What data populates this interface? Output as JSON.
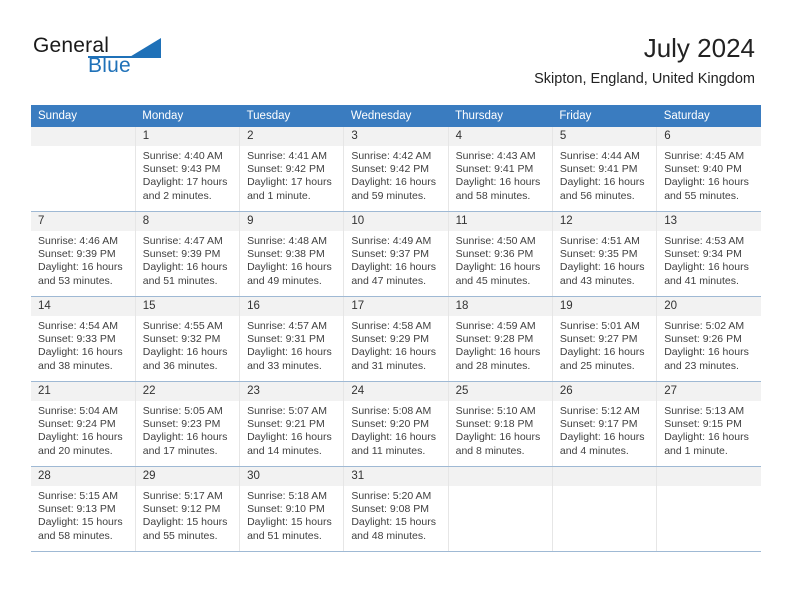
{
  "brand": {
    "line1": "General",
    "line2": "Blue",
    "accent_color": "#1f71b8",
    "triangle_icon": "triangle-logo-icon"
  },
  "header": {
    "month_title": "July 2024",
    "location": "Skipton, England, United Kingdom"
  },
  "calendar": {
    "header_bg": "#3a7cc0",
    "weekday_headers": [
      "Sunday",
      "Monday",
      "Tuesday",
      "Wednesday",
      "Thursday",
      "Friday",
      "Saturday"
    ],
    "weeks": [
      [
        {
          "day": "",
          "sunrise": "",
          "sunset": "",
          "daylight": ""
        },
        {
          "day": "1",
          "sunrise": "Sunrise: 4:40 AM",
          "sunset": "Sunset: 9:43 PM",
          "daylight": "Daylight: 17 hours and 2 minutes."
        },
        {
          "day": "2",
          "sunrise": "Sunrise: 4:41 AM",
          "sunset": "Sunset: 9:42 PM",
          "daylight": "Daylight: 17 hours and 1 minute."
        },
        {
          "day": "3",
          "sunrise": "Sunrise: 4:42 AM",
          "sunset": "Sunset: 9:42 PM",
          "daylight": "Daylight: 16 hours and 59 minutes."
        },
        {
          "day": "4",
          "sunrise": "Sunrise: 4:43 AM",
          "sunset": "Sunset: 9:41 PM",
          "daylight": "Daylight: 16 hours and 58 minutes."
        },
        {
          "day": "5",
          "sunrise": "Sunrise: 4:44 AM",
          "sunset": "Sunset: 9:41 PM",
          "daylight": "Daylight: 16 hours and 56 minutes."
        },
        {
          "day": "6",
          "sunrise": "Sunrise: 4:45 AM",
          "sunset": "Sunset: 9:40 PM",
          "daylight": "Daylight: 16 hours and 55 minutes."
        }
      ],
      [
        {
          "day": "7",
          "sunrise": "Sunrise: 4:46 AM",
          "sunset": "Sunset: 9:39 PM",
          "daylight": "Daylight: 16 hours and 53 minutes."
        },
        {
          "day": "8",
          "sunrise": "Sunrise: 4:47 AM",
          "sunset": "Sunset: 9:39 PM",
          "daylight": "Daylight: 16 hours and 51 minutes."
        },
        {
          "day": "9",
          "sunrise": "Sunrise: 4:48 AM",
          "sunset": "Sunset: 9:38 PM",
          "daylight": "Daylight: 16 hours and 49 minutes."
        },
        {
          "day": "10",
          "sunrise": "Sunrise: 4:49 AM",
          "sunset": "Sunset: 9:37 PM",
          "daylight": "Daylight: 16 hours and 47 minutes."
        },
        {
          "day": "11",
          "sunrise": "Sunrise: 4:50 AM",
          "sunset": "Sunset: 9:36 PM",
          "daylight": "Daylight: 16 hours and 45 minutes."
        },
        {
          "day": "12",
          "sunrise": "Sunrise: 4:51 AM",
          "sunset": "Sunset: 9:35 PM",
          "daylight": "Daylight: 16 hours and 43 minutes."
        },
        {
          "day": "13",
          "sunrise": "Sunrise: 4:53 AM",
          "sunset": "Sunset: 9:34 PM",
          "daylight": "Daylight: 16 hours and 41 minutes."
        }
      ],
      [
        {
          "day": "14",
          "sunrise": "Sunrise: 4:54 AM",
          "sunset": "Sunset: 9:33 PM",
          "daylight": "Daylight: 16 hours and 38 minutes."
        },
        {
          "day": "15",
          "sunrise": "Sunrise: 4:55 AM",
          "sunset": "Sunset: 9:32 PM",
          "daylight": "Daylight: 16 hours and 36 minutes."
        },
        {
          "day": "16",
          "sunrise": "Sunrise: 4:57 AM",
          "sunset": "Sunset: 9:31 PM",
          "daylight": "Daylight: 16 hours and 33 minutes."
        },
        {
          "day": "17",
          "sunrise": "Sunrise: 4:58 AM",
          "sunset": "Sunset: 9:29 PM",
          "daylight": "Daylight: 16 hours and 31 minutes."
        },
        {
          "day": "18",
          "sunrise": "Sunrise: 4:59 AM",
          "sunset": "Sunset: 9:28 PM",
          "daylight": "Daylight: 16 hours and 28 minutes."
        },
        {
          "day": "19",
          "sunrise": "Sunrise: 5:01 AM",
          "sunset": "Sunset: 9:27 PM",
          "daylight": "Daylight: 16 hours and 25 minutes."
        },
        {
          "day": "20",
          "sunrise": "Sunrise: 5:02 AM",
          "sunset": "Sunset: 9:26 PM",
          "daylight": "Daylight: 16 hours and 23 minutes."
        }
      ],
      [
        {
          "day": "21",
          "sunrise": "Sunrise: 5:04 AM",
          "sunset": "Sunset: 9:24 PM",
          "daylight": "Daylight: 16 hours and 20 minutes."
        },
        {
          "day": "22",
          "sunrise": "Sunrise: 5:05 AM",
          "sunset": "Sunset: 9:23 PM",
          "daylight": "Daylight: 16 hours and 17 minutes."
        },
        {
          "day": "23",
          "sunrise": "Sunrise: 5:07 AM",
          "sunset": "Sunset: 9:21 PM",
          "daylight": "Daylight: 16 hours and 14 minutes."
        },
        {
          "day": "24",
          "sunrise": "Sunrise: 5:08 AM",
          "sunset": "Sunset: 9:20 PM",
          "daylight": "Daylight: 16 hours and 11 minutes."
        },
        {
          "day": "25",
          "sunrise": "Sunrise: 5:10 AM",
          "sunset": "Sunset: 9:18 PM",
          "daylight": "Daylight: 16 hours and 8 minutes."
        },
        {
          "day": "26",
          "sunrise": "Sunrise: 5:12 AM",
          "sunset": "Sunset: 9:17 PM",
          "daylight": "Daylight: 16 hours and 4 minutes."
        },
        {
          "day": "27",
          "sunrise": "Sunrise: 5:13 AM",
          "sunset": "Sunset: 9:15 PM",
          "daylight": "Daylight: 16 hours and 1 minute."
        }
      ],
      [
        {
          "day": "28",
          "sunrise": "Sunrise: 5:15 AM",
          "sunset": "Sunset: 9:13 PM",
          "daylight": "Daylight: 15 hours and 58 minutes."
        },
        {
          "day": "29",
          "sunrise": "Sunrise: 5:17 AM",
          "sunset": "Sunset: 9:12 PM",
          "daylight": "Daylight: 15 hours and 55 minutes."
        },
        {
          "day": "30",
          "sunrise": "Sunrise: 5:18 AM",
          "sunset": "Sunset: 9:10 PM",
          "daylight": "Daylight: 15 hours and 51 minutes."
        },
        {
          "day": "31",
          "sunrise": "Sunrise: 5:20 AM",
          "sunset": "Sunset: 9:08 PM",
          "daylight": "Daylight: 15 hours and 48 minutes."
        },
        {
          "day": "",
          "sunrise": "",
          "sunset": "",
          "daylight": ""
        },
        {
          "day": "",
          "sunrise": "",
          "sunset": "",
          "daylight": ""
        },
        {
          "day": "",
          "sunrise": "",
          "sunset": "",
          "daylight": ""
        }
      ]
    ]
  }
}
